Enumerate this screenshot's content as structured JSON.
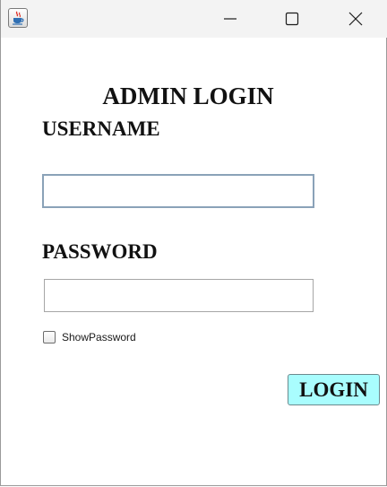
{
  "window": {
    "controls": {
      "minimize_icon": "minimize-icon",
      "maximize_icon": "maximize-icon",
      "close_icon": "close-icon"
    },
    "app_icon": "java-cup-icon"
  },
  "form": {
    "heading": "ADMIN LOGIN",
    "username_label": "USERNAME",
    "username_value": "",
    "password_label": "PASSWORD",
    "password_value": "",
    "show_password_label": "ShowPassword",
    "show_password_checked": false,
    "login_label": "LOGIN"
  },
  "colors": {
    "login_button_bg": "#a9fdfe",
    "titlebar_bg": "#f3f3f3"
  }
}
